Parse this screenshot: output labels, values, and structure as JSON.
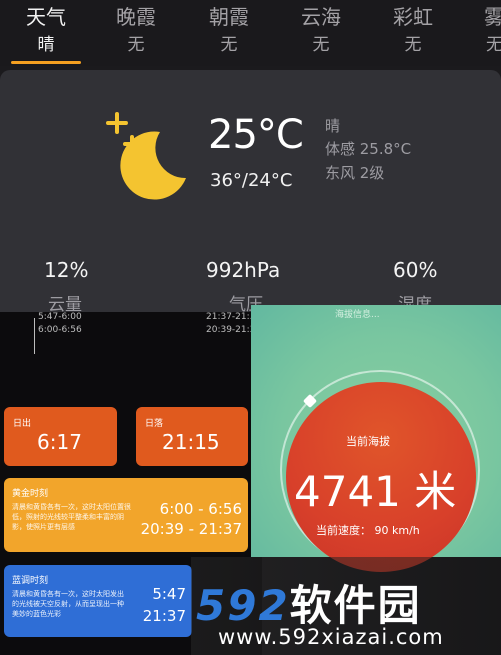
{
  "tabs": [
    {
      "name": "天气",
      "value": "晴"
    },
    {
      "name": "晚霞",
      "value": "无"
    },
    {
      "name": "朝霞",
      "value": "无"
    },
    {
      "name": "云海",
      "value": "无"
    },
    {
      "name": "彩虹",
      "value": "无"
    },
    {
      "name": "雾",
      "value": "无"
    }
  ],
  "weather": {
    "icon": "moon-stars-icon",
    "temperature": "25°C",
    "range": "36°/24°C",
    "condition": "晴",
    "feels_like": "体感 25.8°C",
    "wind": "东风 2级"
  },
  "stats": [
    {
      "value": "12%",
      "label": "云量"
    },
    {
      "value": "992hPa",
      "label": "气压"
    },
    {
      "value": "60%",
      "label": "湿度"
    }
  ],
  "timeline": {
    "times_a": "5:47-6:00",
    "times_b": "6:00-6:56",
    "times_c": "21:37-21:...",
    "times_d": "20:39-21:37",
    "note": "海拔信息..."
  },
  "sunrise": {
    "label": "日出",
    "time": "6:17"
  },
  "sunset": {
    "label": "日落",
    "time": "21:15"
  },
  "golden_hour": {
    "title": "黄金时刻",
    "desc": "清晨和黄昏各有一次，这时太阳位置很低，照射的光线较平整柔和丰富的阴影，使照片更有层感",
    "time1": "6:00 - 6:56",
    "time2": "20:39 - 21:37"
  },
  "blue_hour": {
    "title": "蓝调时刻",
    "desc": "清晨和黄昏各有一次，这时太阳发出的光线被天空反射，从而呈现出一种美妙的蓝色光彩",
    "time1": "5:47",
    "time2": "21:37"
  },
  "altitude": {
    "label": "当前海拔",
    "value": "4741 米",
    "speed": "当前速度： 90 km/h"
  },
  "watermark": {
    "number": "592",
    "text": "软件园",
    "url": "www.592xiazai.com"
  },
  "colors": {
    "accent": "#f5a021",
    "sunrise_box": "#e05a1e",
    "golden_box": "#f2a52b",
    "blue_box": "#2f6ed6",
    "altitude_circle": "#d8402a",
    "teal_bg": "#79c6a0"
  }
}
